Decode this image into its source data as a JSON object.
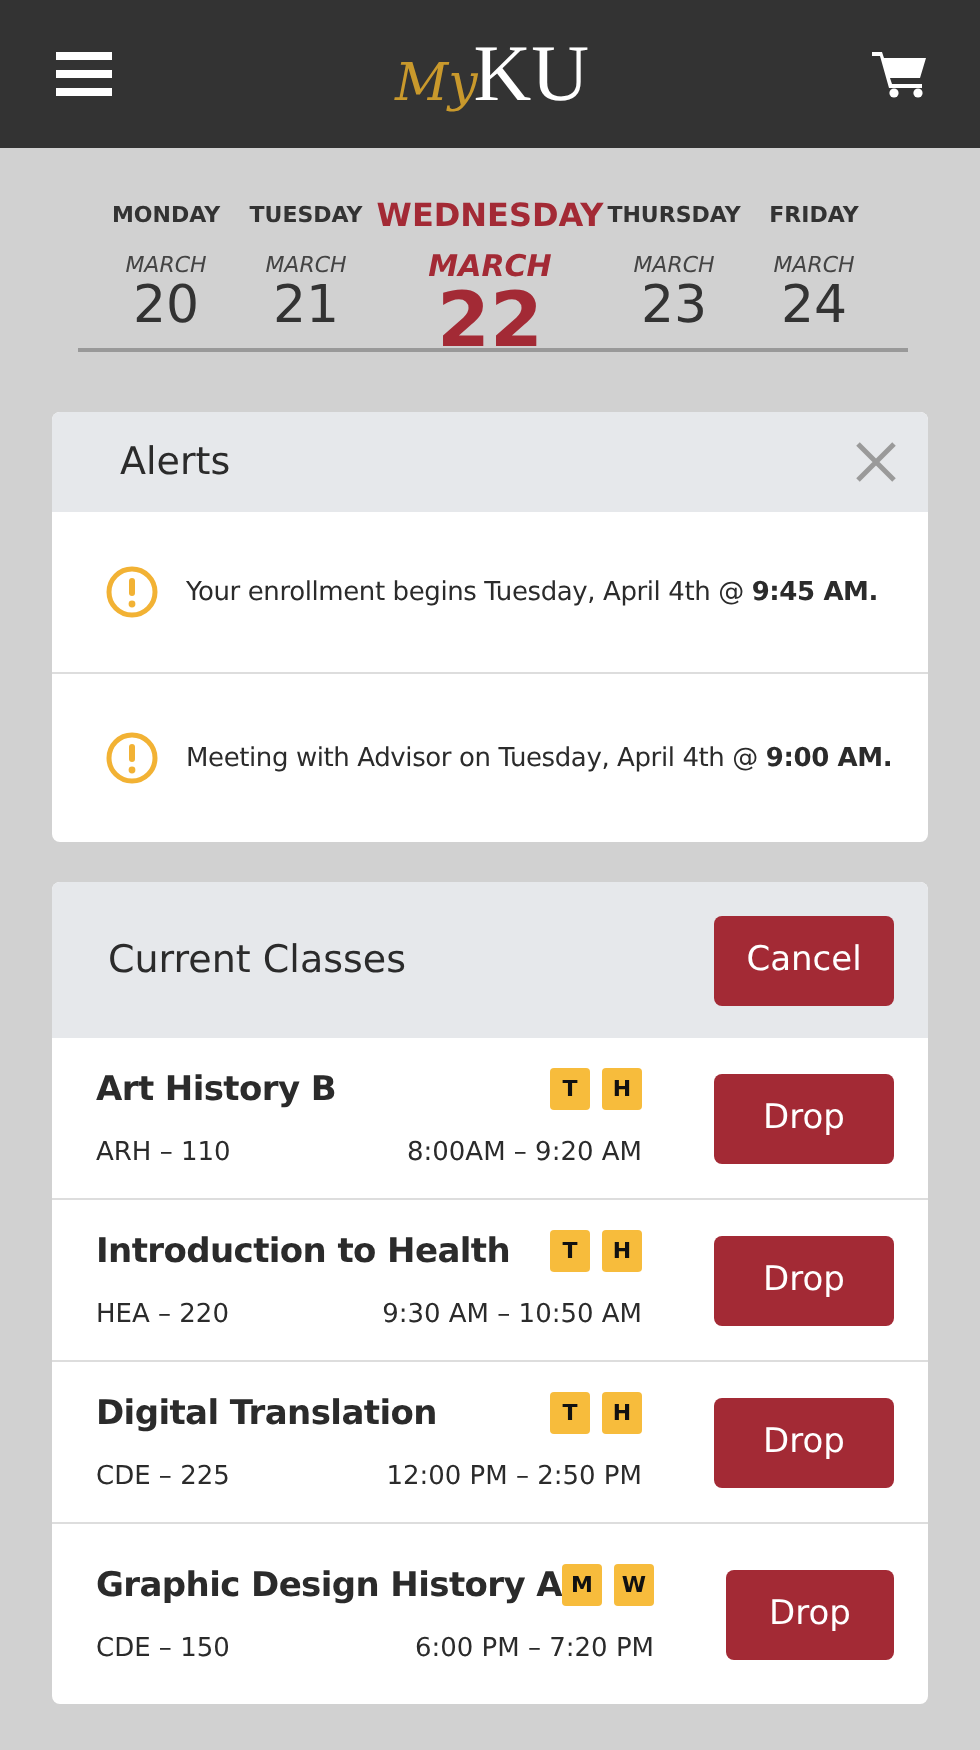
{
  "header": {
    "logo_script": "My",
    "logo_letters": "KU"
  },
  "days": [
    {
      "weekday": "MONDAY",
      "month": "MARCH",
      "date": "20",
      "selected": false
    },
    {
      "weekday": "TUESDAY",
      "month": "MARCH",
      "date": "21",
      "selected": false
    },
    {
      "weekday": "WEDNESDAY",
      "month": "MARCH",
      "date": "22",
      "selected": true
    },
    {
      "weekday": "THURSDAY",
      "month": "MARCH",
      "date": "23",
      "selected": false
    },
    {
      "weekday": "FRIDAY",
      "month": "MARCH",
      "date": "24",
      "selected": false
    }
  ],
  "alerts": {
    "title": "Alerts",
    "items": [
      {
        "text": "Your enrollment begins Tuesday, April  4th @ **9:45 AM.**"
      },
      {
        "text": "Meeting with Advisor on Tuesday, April  4th @ **9:00 AM.**"
      }
    ]
  },
  "classes": {
    "title": "Current Classes",
    "action": "Cancel",
    "items": [
      {
        "name": "Art History B",
        "code": "ARH – 110",
        "days": [
          "T",
          "H"
        ],
        "time": "8:00AM – 9:20 AM",
        "button": "Drop"
      },
      {
        "name": "Introduction to Health",
        "code": "HEA – 220",
        "days": [
          "T",
          "H"
        ],
        "time": "9:30 AM – 10:50 AM",
        "button": "Drop"
      },
      {
        "name": "Digital Translation",
        "code": "CDE – 225",
        "days": [
          "T",
          "H"
        ],
        "time": "12:00 PM – 2:50 PM",
        "button": "Drop"
      },
      {
        "name": "Graphic Design History A",
        "code": "CDE – 150",
        "days": [
          "M",
          "W"
        ],
        "time": "6:00 PM – 7:20 PM",
        "button": "Drop"
      }
    ]
  }
}
